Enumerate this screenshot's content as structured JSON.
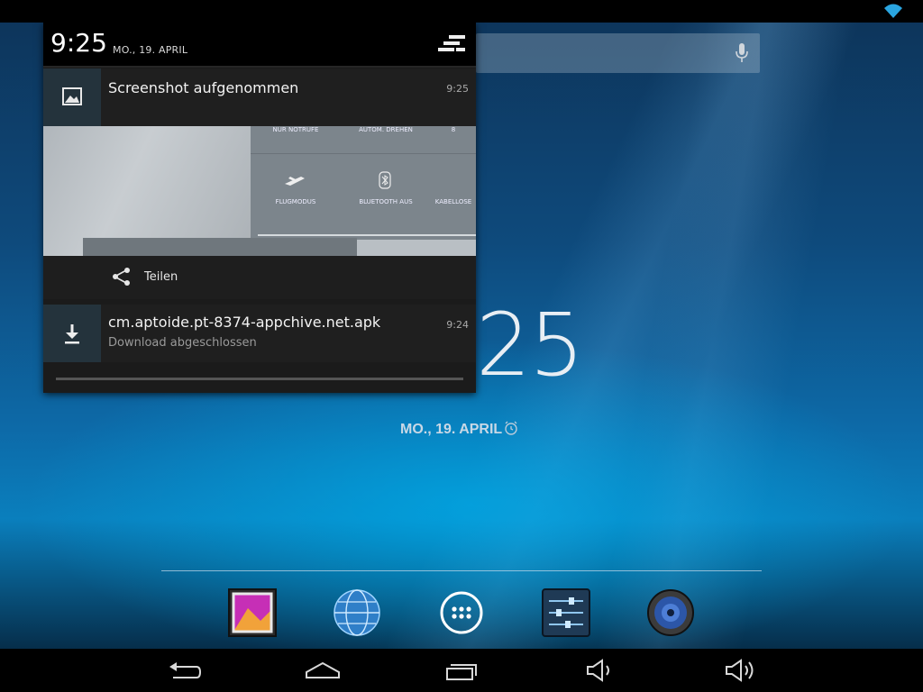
{
  "status_bar": {
    "wifi_icon": "wifi-icon"
  },
  "launcher": {
    "clock_partial": "25",
    "date": "MO., 19. APRIL",
    "dock": [
      "gallery-icon",
      "browser-icon",
      "apps-icon",
      "settings-icon",
      "music-icon"
    ]
  },
  "shade": {
    "time": "9:25",
    "date": "MO., 19. APRIL",
    "notifications": [
      {
        "title": "Screenshot aufgenommen",
        "time": "9:25",
        "icon": "image-icon",
        "action": "Teilen",
        "preview_labels": {
          "row1": [
            "NUR NOTRUFE",
            "AUTOM. DREHEN",
            "8"
          ],
          "row2": [
            "FLUGMODUS",
            "BLUETOOTH AUS",
            "KABELLOSE"
          ]
        }
      },
      {
        "title": "cm.aptoide.pt-8374-appchive.net.apk",
        "subtitle": "Download abgeschlossen",
        "time": "9:24",
        "icon": "download-icon"
      }
    ]
  },
  "nav": [
    "back-icon",
    "home-icon",
    "recent-apps-icon",
    "volume-down-icon",
    "volume-up-icon"
  ]
}
